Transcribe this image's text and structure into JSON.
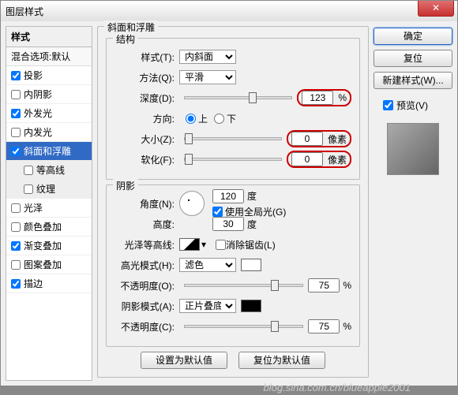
{
  "window": {
    "title": "图层样式"
  },
  "left": {
    "header": "样式",
    "sub": "混合选项:默认",
    "items": [
      {
        "label": "投影",
        "checked": true,
        "sel": false
      },
      {
        "label": "内阴影",
        "checked": false,
        "sel": false
      },
      {
        "label": "外发光",
        "checked": true,
        "sel": false
      },
      {
        "label": "内发光",
        "checked": false,
        "sel": false
      },
      {
        "label": "斜面和浮雕",
        "checked": true,
        "sel": true
      },
      {
        "label": "等高线",
        "checked": false,
        "sel": false,
        "sub": true
      },
      {
        "label": "纹理",
        "checked": false,
        "sel": false,
        "sub": true
      },
      {
        "label": "光泽",
        "checked": false,
        "sel": false
      },
      {
        "label": "颜色叠加",
        "checked": false,
        "sel": false
      },
      {
        "label": "渐变叠加",
        "checked": true,
        "sel": false
      },
      {
        "label": "图案叠加",
        "checked": false,
        "sel": false
      },
      {
        "label": "描边",
        "checked": true,
        "sel": false
      }
    ]
  },
  "bevel": {
    "title": "斜面和浮雕",
    "structure": {
      "legend": "结构",
      "style_lbl": "样式(T):",
      "style_val": "内斜面",
      "tech_lbl": "方法(Q):",
      "tech_val": "平滑",
      "depth_lbl": "深度(D):",
      "depth_val": "123",
      "depth_unit": "%",
      "dir_lbl": "方向:",
      "up": "上",
      "down": "下",
      "size_lbl": "大小(Z):",
      "size_val": "0",
      "size_unit": "像素",
      "soft_lbl": "软化(F):",
      "soft_val": "0",
      "soft_unit": "像素"
    },
    "shading": {
      "legend": "阴影",
      "angle_lbl": "角度(N):",
      "angle_val": "120",
      "angle_unit": "度",
      "global": "使用全局光(G)",
      "alt_lbl": "高度:",
      "alt_val": "30",
      "alt_unit": "度",
      "gloss_lbl": "光泽等高线:",
      "anti": "消除锯齿(L)",
      "hi_mode_lbl": "高光模式(H):",
      "hi_mode_val": "滤色",
      "hi_op_lbl": "不透明度(O):",
      "hi_op_val": "75",
      "pct": "%",
      "sh_mode_lbl": "阴影模式(A):",
      "sh_mode_val": "正片叠底",
      "sh_op_lbl": "不透明度(C):",
      "sh_op_val": "75"
    },
    "defaults": {
      "set": "设置为默认值",
      "reset": "复位为默认值"
    }
  },
  "right": {
    "ok": "确定",
    "cancel": "复位",
    "newstyle": "新建样式(W)...",
    "preview": "预览(V)"
  },
  "watermark": "blog.sina.com.cn/blueapple2001"
}
